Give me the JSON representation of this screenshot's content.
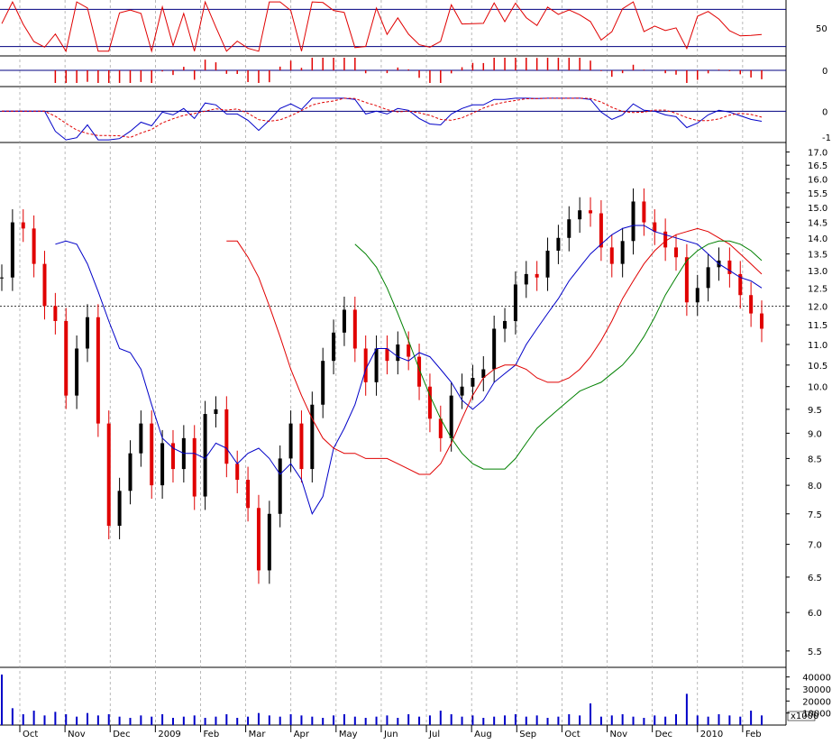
{
  "colors": {
    "up_candle": "#000000",
    "down_candle": "#e00000",
    "ma_short": "#0000c8",
    "ma_mid": "#e00000",
    "ma_long": "#008000",
    "volume": "#0000c8",
    "grid": "#9a9a9a",
    "rsi": "#e00000",
    "osc_bars": "#e00000",
    "macd": "#0000c8",
    "macd_signal": "#e00000",
    "ref_line": "#000080"
  },
  "chart_data": [
    {
      "type": "line",
      "panel": "rsi",
      "yticks": [
        "50"
      ],
      "ref_levels": [
        70,
        30
      ],
      "ylim": [
        20,
        80
      ]
    },
    {
      "type": "bar",
      "panel": "oscillator",
      "yticks": [
        "0"
      ],
      "ylim": [
        -1,
        1
      ]
    },
    {
      "type": "line",
      "panel": "macd",
      "yticks": [
        "0",
        "-1"
      ],
      "ylim": [
        -1.2,
        0.6
      ]
    },
    {
      "type": "line",
      "panel": "price",
      "subtype": "candlestick",
      "yticks": [
        "17.0",
        "16.5",
        "16.0",
        "15.5",
        "15.0",
        "14.5",
        "14.0",
        "13.5",
        "13.0",
        "12.5",
        "12.0",
        "11.5",
        "11.0",
        "10.5",
        "10.0",
        "9.5",
        "9.0",
        "8.5",
        "8.0",
        "7.5",
        "7.0",
        "6.5",
        "6.0",
        "5.5"
      ],
      "log_scale": true,
      "ylim": [
        5.3,
        17.3
      ],
      "reference_line": 12.0,
      "x": [
        "2008-09-19",
        "2008-09-26",
        "2008-10-03",
        "2008-10-10",
        "2008-10-17",
        "2008-10-24",
        "2008-10-31",
        "2008-11-07",
        "2008-11-14",
        "2008-11-21",
        "2008-11-28",
        "2008-12-05",
        "2008-12-12",
        "2008-12-19",
        "2008-12-26",
        "2009-01-02",
        "2009-01-09",
        "2009-01-16",
        "2009-01-23",
        "2009-01-30",
        "2009-02-06",
        "2009-02-13",
        "2009-02-20",
        "2009-02-27",
        "2009-03-06",
        "2009-03-13",
        "2009-03-20",
        "2009-03-27",
        "2009-04-03",
        "2009-04-10",
        "2009-04-17",
        "2009-04-24",
        "2009-05-01",
        "2009-05-08",
        "2009-05-15",
        "2009-05-22",
        "2009-05-29",
        "2009-06-05",
        "2009-06-12",
        "2009-06-19",
        "2009-06-26",
        "2009-07-03",
        "2009-07-10",
        "2009-07-17",
        "2009-07-24",
        "2009-07-31",
        "2009-08-07",
        "2009-08-14",
        "2009-08-21",
        "2009-08-28",
        "2009-09-04",
        "2009-09-11",
        "2009-09-18",
        "2009-09-25",
        "2009-10-02",
        "2009-10-09",
        "2009-10-16",
        "2009-10-23",
        "2009-10-30",
        "2009-11-06",
        "2009-11-13",
        "2009-11-20",
        "2009-11-27",
        "2009-12-04",
        "2009-12-11",
        "2009-12-18",
        "2009-12-25",
        "2010-01-01",
        "2010-01-08",
        "2010-01-15",
        "2010-01-22",
        "2010-01-29"
      ],
      "series": [
        {
          "name": "",
          "kind": "close",
          "values": [
            12.8,
            14.5,
            14.3,
            13.2,
            12.0,
            11.6,
            9.8,
            10.9,
            11.7,
            9.2,
            7.3,
            7.9,
            8.6,
            9.2,
            8.0,
            8.8,
            8.3,
            8.9,
            7.8,
            9.4,
            9.5,
            8.4,
            8.1,
            7.6,
            6.6,
            7.5,
            8.5,
            9.2,
            8.3,
            9.6,
            10.6,
            11.3,
            11.9,
            10.9,
            10.1,
            10.9,
            10.6,
            11.0,
            10.7,
            10.0,
            9.3,
            8.9,
            9.8,
            10.0,
            10.2,
            10.4,
            11.4,
            11.6,
            12.6,
            12.9,
            12.8,
            13.6,
            14.0,
            14.6,
            14.9,
            14.8,
            13.7,
            13.2,
            13.9,
            15.2,
            14.5,
            14.2,
            13.7,
            13.4,
            12.1,
            12.5,
            13.1,
            13.3,
            12.9,
            12.3,
            11.8,
            11.4
          ]
        },
        {
          "name": "",
          "kind": "moving_average",
          "color_key": "ma_short",
          "values": [
            13.8,
            13.9,
            13.8,
            13.2,
            12.4,
            11.6,
            10.9,
            10.8,
            10.4,
            9.6,
            8.9,
            8.7,
            8.6,
            8.6,
            8.5,
            8.8,
            8.7,
            8.4,
            8.6,
            8.7,
            8.5,
            8.2,
            8.4,
            8.1,
            7.5,
            7.8,
            8.7,
            9.1,
            9.6,
            10.4,
            10.9,
            10.9,
            10.7,
            10.6,
            10.8,
            10.7,
            10.4,
            10.1,
            9.7,
            9.5,
            9.7,
            10.1,
            10.3,
            10.5,
            11.0,
            11.4,
            11.8,
            12.2,
            12.7,
            13.1,
            13.5,
            13.8,
            14.1,
            14.3,
            14.4,
            14.4,
            14.2,
            14.1,
            14.0,
            13.9,
            13.8,
            13.5,
            13.2,
            13.0,
            12.8,
            12.7,
            12.5
          ]
        },
        {
          "name": "",
          "kind": "moving_average",
          "color_key": "ma_mid",
          "values": [
            13.9,
            13.9,
            13.4,
            12.8,
            12.0,
            11.2,
            10.4,
            9.8,
            9.3,
            8.9,
            8.7,
            8.6,
            8.6,
            8.5,
            8.5,
            8.5,
            8.4,
            8.3,
            8.2,
            8.2,
            8.4,
            8.8,
            9.3,
            9.8,
            10.2,
            10.4,
            10.5,
            10.5,
            10.4,
            10.2,
            10.1,
            10.1,
            10.2,
            10.4,
            10.7,
            11.1,
            11.6,
            12.2,
            12.7,
            13.2,
            13.6,
            13.9,
            14.1,
            14.2,
            14.3,
            14.2,
            14.0,
            13.8,
            13.5,
            13.2,
            12.9
          ]
        },
        {
          "name": "",
          "kind": "moving_average",
          "color_key": "ma_long",
          "values": [
            13.8,
            13.5,
            13.1,
            12.5,
            11.8,
            11.1,
            10.4,
            9.8,
            9.3,
            8.9,
            8.6,
            8.4,
            8.3,
            8.3,
            8.3,
            8.5,
            8.8,
            9.1,
            9.3,
            9.5,
            9.7,
            9.9,
            10.0,
            10.1,
            10.3,
            10.5,
            10.8,
            11.2,
            11.7,
            12.3,
            12.8,
            13.3,
            13.6,
            13.8,
            13.9,
            13.9,
            13.8,
            13.6,
            13.3
          ]
        }
      ]
    },
    {
      "type": "bar",
      "panel": "volume",
      "yticks": [
        "40000",
        "30000",
        "20000",
        "10000"
      ],
      "unit_label": "x1000",
      "ylim": [
        0,
        48000
      ],
      "series": [
        {
          "name": "",
          "values": [
            42000,
            14000,
            9000,
            12000,
            8000,
            11000,
            9000,
            7000,
            10000,
            8000,
            9000,
            7000,
            6000,
            8000,
            7000,
            9000,
            6000,
            7000,
            8000,
            6000,
            7000,
            9000,
            6000,
            7000,
            10000,
            8000,
            7000,
            9000,
            8000,
            7000,
            6000,
            8000,
            9000,
            7000,
            6000,
            7000,
            8000,
            6000,
            9000,
            7000,
            8000,
            12000,
            9000,
            7000,
            8000,
            6000,
            7000,
            8000,
            9000,
            7000,
            8000,
            6000,
            7000,
            9000,
            8000,
            18000,
            7000,
            8000,
            9000,
            7000,
            6000,
            8000,
            7000,
            9000,
            26000,
            8000,
            7000,
            9000,
            8000,
            7000,
            12000,
            8000
          ]
        }
      ]
    }
  ],
  "x_axis": {
    "labels": [
      "Oct",
      "Nov",
      "Dec",
      "2009",
      "Feb",
      "Mar",
      "Apr",
      "May",
      "Jun",
      "Jul",
      "Aug",
      "Sep",
      "Oct",
      "Nov",
      "Dec",
      "2010",
      "Feb"
    ]
  }
}
